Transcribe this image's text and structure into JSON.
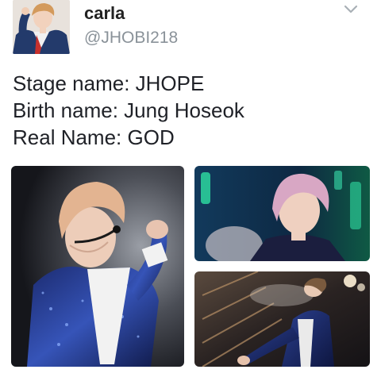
{
  "tweet": {
    "display_name": "carla",
    "handle": "@JHOBI218",
    "lines": [
      "Stage name: JHOPE",
      "Birth name: Jung Hoseok",
      "Real Name: GOD"
    ]
  },
  "icons": {
    "more": "chevron-down-icon"
  },
  "colors": {
    "handle": "#8a9299",
    "text": "#1f2127"
  }
}
